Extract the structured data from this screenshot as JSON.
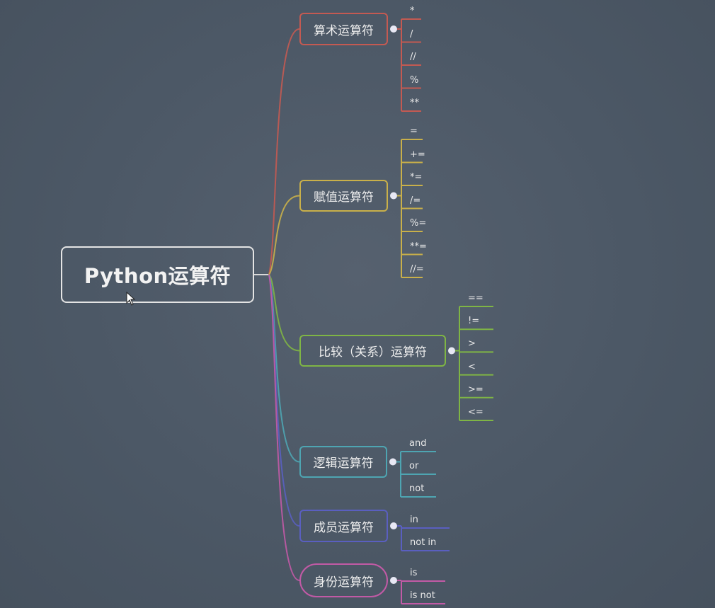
{
  "root": {
    "label": "Python运算符"
  },
  "branches": [
    {
      "id": "arithmetic",
      "label": "算术运算符",
      "color": "#c45a52",
      "leaves": [
        "*",
        "/",
        "//",
        "%",
        "**"
      ]
    },
    {
      "id": "assignment",
      "label": "赋值运算符",
      "color": "#c9b04a",
      "leaves": [
        "=",
        "+=",
        "*=",
        "/=",
        "%=",
        "**=",
        "//="
      ]
    },
    {
      "id": "comparison",
      "label": "比较（关系）运算符",
      "color": "#7fb545",
      "leaves": [
        "==",
        "!=",
        ">",
        "<",
        ">=",
        "<="
      ]
    },
    {
      "id": "logical",
      "label": "逻辑运算符",
      "color": "#4ea5b2",
      "leaves": [
        "and",
        "or",
        "not"
      ]
    },
    {
      "id": "membership",
      "label": "成员运算符",
      "color": "#5a5fc0",
      "leaves": [
        "in",
        "not in"
      ]
    },
    {
      "id": "identity",
      "label": "身份运算符",
      "color": "#c25aa6",
      "leaves": [
        "is",
        "is not"
      ]
    }
  ],
  "colors": {
    "background": "#4d5a68",
    "root_border": "#e4e4e4",
    "node_dot": "#e8e8f4"
  },
  "icons": {
    "pointer": "mouse-cursor-icon"
  }
}
